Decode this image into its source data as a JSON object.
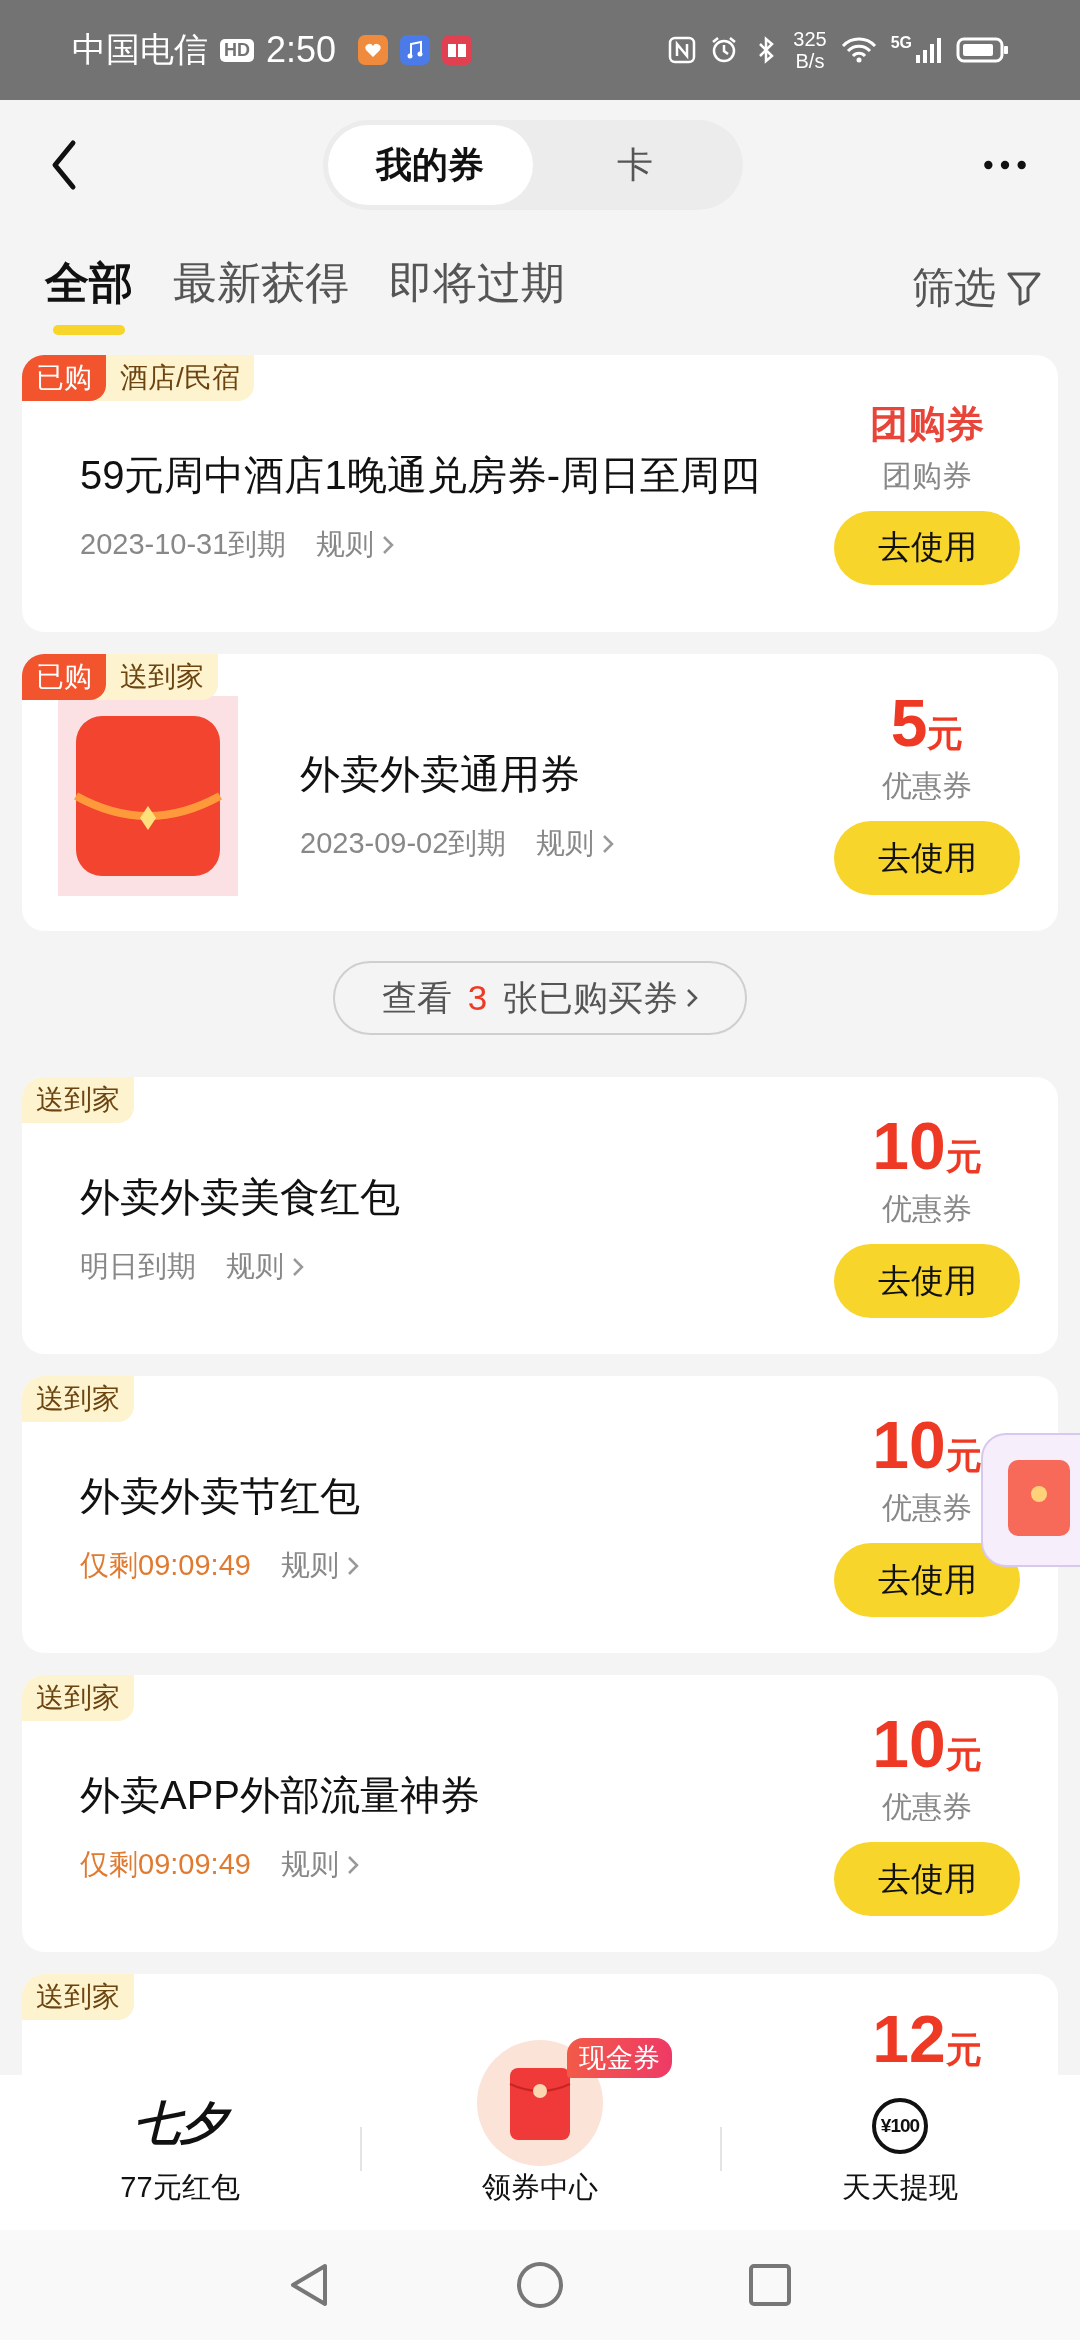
{
  "status_bar": {
    "carrier": "中国电信",
    "hd": "HD",
    "time": "2:50",
    "speed_value": "325",
    "speed_unit": "B/s",
    "network": "5G"
  },
  "header": {
    "tabs": [
      {
        "label": "我的券",
        "selected": true
      },
      {
        "label": "卡",
        "selected": false
      }
    ]
  },
  "filter_tabs": [
    {
      "label": "全部",
      "selected": true
    },
    {
      "label": "最新获得",
      "selected": false
    },
    {
      "label": "即将过期",
      "selected": false
    }
  ],
  "filter": "筛选",
  "coupons": [
    {
      "tags": [
        {
          "label": "已购",
          "kind": "purchased"
        },
        {
          "label": "酒店/民宿",
          "kind": "category"
        }
      ],
      "image": false,
      "title": "59元周中酒店1晚通兑房券-周日至周四",
      "expiry": {
        "kind": "date",
        "text": "2023-10-31到期"
      },
      "rules": "规则",
      "value": {
        "kind": "text",
        "text": "团购券"
      },
      "type": "团购券",
      "button": "去使用"
    },
    {
      "tags": [
        {
          "label": "已购",
          "kind": "purchased"
        },
        {
          "label": "送到家",
          "kind": "category"
        }
      ],
      "image": true,
      "title": "外卖外卖通用券",
      "expiry": {
        "kind": "date",
        "text": "2023-09-02到期"
      },
      "rules": "规则",
      "value": {
        "kind": "amount",
        "number": "5",
        "unit": "元"
      },
      "type": "优惠券",
      "button": "去使用"
    },
    {
      "kind": "more",
      "prefix": "查看",
      "count": "3",
      "suffix": "张已购买券"
    },
    {
      "tags": [
        {
          "label": "送到家",
          "kind": "category"
        }
      ],
      "image": false,
      "title": "外卖外卖美食红包",
      "expiry": {
        "kind": "date",
        "text": "明日到期"
      },
      "rules": "规则",
      "value": {
        "kind": "amount",
        "number": "10",
        "unit": "元"
      },
      "type": "优惠券",
      "button": "去使用"
    },
    {
      "tags": [
        {
          "label": "送到家",
          "kind": "category"
        }
      ],
      "image": false,
      "title": "外卖外卖节红包",
      "expiry": {
        "kind": "countdown",
        "text": "仅剩09:09:49"
      },
      "rules": "规则",
      "value": {
        "kind": "amount",
        "number": "10",
        "unit": "元"
      },
      "type": "优惠券",
      "button": "去使用"
    },
    {
      "tags": [
        {
          "label": "送到家",
          "kind": "category"
        }
      ],
      "image": false,
      "title": "外卖APP外部流量神券",
      "expiry": {
        "kind": "countdown",
        "text": "仅剩09:09:49"
      },
      "rules": "规则",
      "value": {
        "kind": "amount",
        "number": "10",
        "unit": "元"
      },
      "type": "优惠券",
      "button": "去使用"
    },
    {
      "tags": [
        {
          "label": "送到家",
          "kind": "category"
        }
      ],
      "image": false,
      "value": {
        "kind": "amount",
        "number": "12",
        "unit": "元"
      }
    }
  ],
  "bottom_nav": [
    {
      "kind": "logo",
      "logo_text": "七夕",
      "label": "77元红包"
    },
    {
      "kind": "envelope",
      "badge": "现金券",
      "label": "领券中心"
    },
    {
      "kind": "cash",
      "icon_text": "¥100",
      "label": "天天提现"
    }
  ]
}
